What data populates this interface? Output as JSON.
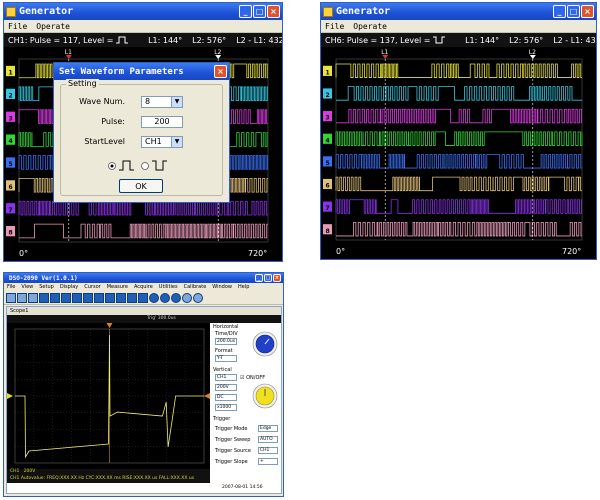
{
  "window1": {
    "title": "Generator",
    "menu": [
      "File",
      "Operate"
    ],
    "info": {
      "channel_text": "CH1: Pulse = 117, Level =",
      "l1": "L1: 144°",
      "l2": "L2: 576°",
      "diff": "L2 - L1: 432°"
    },
    "cursor_labels": [
      "L1",
      "L2"
    ],
    "axis_start": "0°",
    "axis_end": "720°",
    "channel_numbers": [
      "1",
      "2",
      "3",
      "4",
      "5",
      "6",
      "7",
      "8"
    ]
  },
  "window2": {
    "title": "Generator",
    "menu": [
      "File",
      "Operate"
    ],
    "info": {
      "channel_text": "CH6: Pulse = 137, Level =",
      "l1": "L1: 144°",
      "l2": "L2: 576°",
      "diff": "L2 - L1: 432°"
    },
    "cursor_labels": [
      "L1",
      "L2"
    ],
    "axis_start": "0°",
    "axis_end": "720°",
    "channel_numbers": [
      "1",
      "2",
      "3",
      "4",
      "5",
      "6",
      "7",
      "8"
    ]
  },
  "dialog": {
    "title": "Set Waveform Parameters",
    "group": "Setting",
    "wave_num_label": "Wave Num.",
    "wave_num_value": "8",
    "pulse_label": "Pulse:",
    "pulse_value": "200",
    "start_level_label": "StartLevel",
    "start_level_value": "CH1",
    "ok_label": "OK"
  },
  "window3": {
    "title": "DSO-2090 Ver(1.0.1)",
    "menu": [
      "File",
      "View",
      "Setup",
      "Display",
      "Cursor",
      "Measure",
      "Acquire",
      "Utilities",
      "Calibrate",
      "Window",
      "Help"
    ],
    "subwindow_title": "Scope1",
    "trigger_readout": "Trig' 300.0us",
    "horizontal": {
      "section": "Horizontal",
      "time_div_label": "Time/DIV",
      "time_div_value": "200.0us",
      "format_label": "Format",
      "format_value": "Y-T"
    },
    "vertical": {
      "section": "Vertical",
      "channel": "CH1",
      "onoff": "ON/OFF",
      "volt": "200V",
      "coupling": "DC",
      "probe": "x1000"
    },
    "trigger": {
      "section": "Trigger",
      "rows": [
        {
          "label": "Trigger Mode",
          "value": "Edge"
        },
        {
          "label": "Trigger Sweep",
          "value": "AUTO"
        },
        {
          "label": "Trigger Source",
          "value": "CH1"
        },
        {
          "label": "Trigger Slope",
          "value": "+"
        }
      ]
    },
    "status_ch": "CH1",
    "status_volt": "200V",
    "measurement_line": "CH1 Autovalue: FREQ:XXX.XX Hz CYC:XXX.XX ms RISE:XXX.XX us FALL:XXX.XX us",
    "date_time": "2007-08-01  14:56"
  },
  "colors": {
    "ch1": "#e7e33b",
    "ch2": "#35c8e0",
    "ch3": "#d93ce0",
    "ch4": "#34d43a",
    "ch5": "#3a6ff2",
    "ch6": "#e0c07a",
    "ch7": "#8a33e8",
    "ch8": "#e89ab8",
    "titlebar": "#1c52d6",
    "scope_bg": "#000000"
  }
}
